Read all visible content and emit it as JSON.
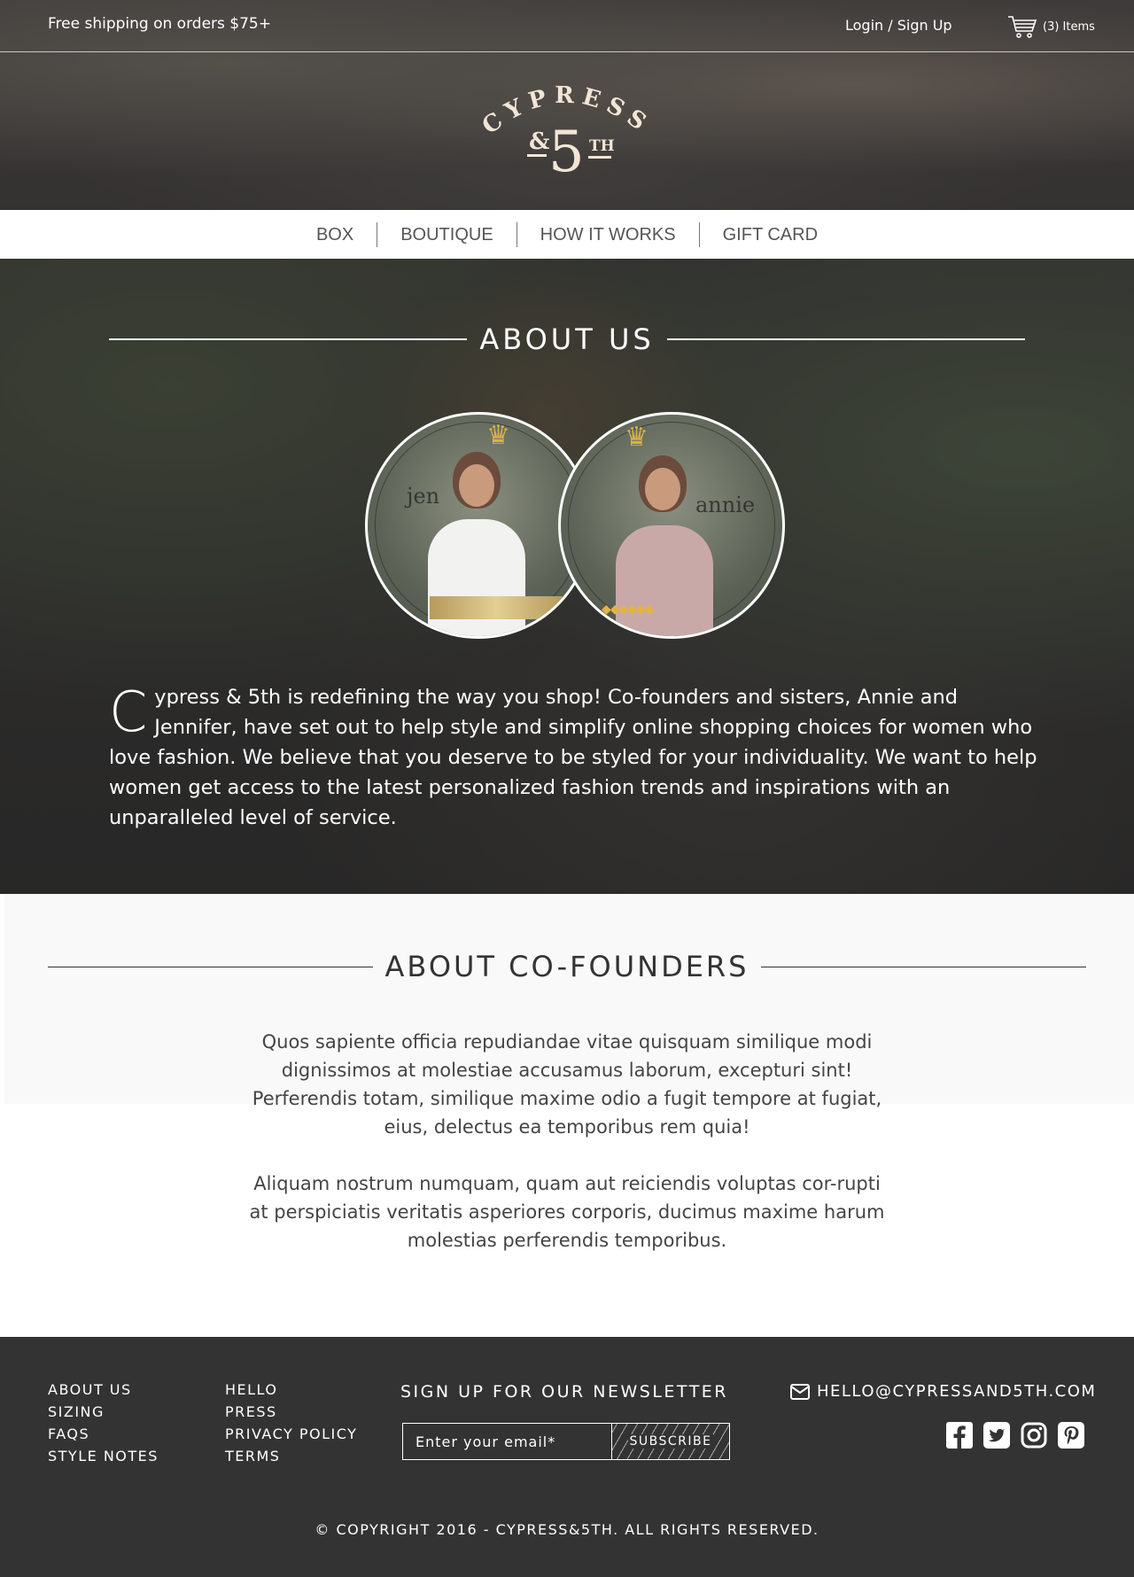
{
  "topbar": {
    "shipping": "Free shipping on orders $75+",
    "login": "Login / Sign Up",
    "cart_count": "(3) Items"
  },
  "logo": {
    "word": "CYPRESS",
    "amp": "&",
    "five": "5",
    "th": "TH"
  },
  "nav": {
    "items": [
      "BOX",
      "BOUTIQUE",
      "HOW IT WORKS",
      "GIFT CARD"
    ]
  },
  "about": {
    "title": "ABOUT US",
    "name_left": "jen",
    "name_right": "annie",
    "dropcap": "C",
    "text": "ypress & 5th  is redefining the way you shop! Co-founders and sisters, Annie and Jennifer, have set out to help style and simplify online shopping choices for women who love fashion. We believe that you deserve to be styled for your individuality. We want to help women get access to the latest personalized fashion trends and inspirations with an unparalleled level of service."
  },
  "cofounders": {
    "title": "ABOUT CO-FOUNDERS",
    "para1": "Quos sapiente officia repudiandae vitae quisquam similique modi dignissimos at molestiae accusamus laborum, excepturi sint! Perferendis totam, similique maxime odio a fugit tempore at fugiat, eius, delectus ea temporibus rem quia!",
    "para2": "Aliquam nostrum numquam, quam aut reiciendis voluptas cor-rupti at perspiciatis veritatis asperiores corporis, ducimus maxime harum molestias perferendis temporibus."
  },
  "footer": {
    "col1": [
      "ABOUT US",
      "SIZING",
      "FAQS",
      "STYLE NOTES"
    ],
    "col2": [
      "HELLO",
      "PRESS",
      "PRIVACY POLICY",
      "TERMS"
    ],
    "newsletter_title": "SIGN UP FOR OUR NEWSLETTER",
    "email_placeholder": "Enter your email*",
    "subscribe": "SUBSCRIBE",
    "contact_email": "HELLO@CYPRESSAND5TH.COM",
    "socials": [
      "facebook-icon",
      "twitter-icon",
      "instagram-icon",
      "pinterest-icon"
    ],
    "copyright": "© COPYRIGHT 2016 - CYPRESS&5TH. ALL RIGHTS RESERVED."
  },
  "colors": {
    "footer_bg": "#333333",
    "logo_cream": "#f1e6d6",
    "gold": "#d9b24a"
  }
}
